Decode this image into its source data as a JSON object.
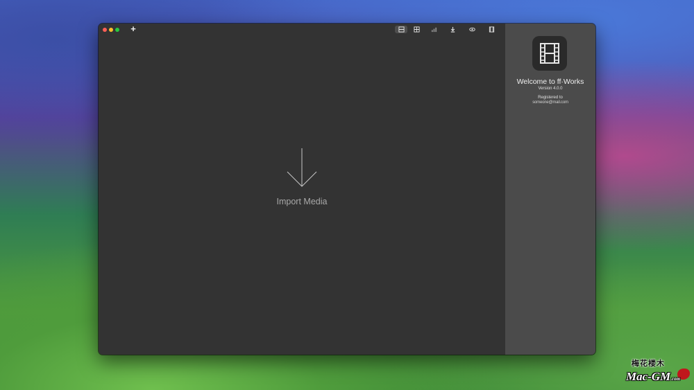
{
  "toolbar": {
    "add_label": "+",
    "buttons": [
      "layout-icon",
      "grid-icon",
      "chart-icon",
      "download-icon",
      "eye-icon",
      "film-icon"
    ]
  },
  "main": {
    "import_label": "Import Media"
  },
  "sidebar": {
    "welcome": "Welcome to ff·Works",
    "version": "Version 4.0.0",
    "registered_label": "Registered to",
    "registered_email": "someone@mail.com"
  },
  "watermark": {
    "line1": "梅花楼木",
    "line2": "Mac-GM",
    "suffix": ".com"
  },
  "colors": {
    "window_bg": "#333333",
    "sidebar_bg": "#4b4b4b",
    "close": "#ff5f57",
    "minimize": "#febc2e",
    "zoom": "#28c840"
  }
}
